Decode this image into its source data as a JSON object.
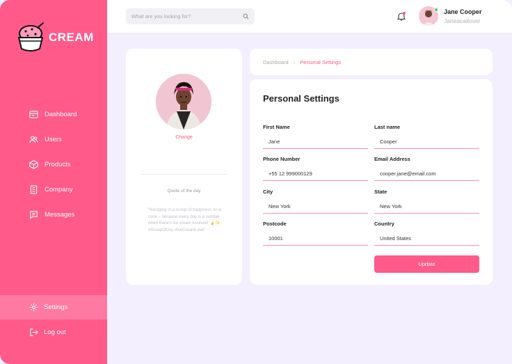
{
  "brand": {
    "name": "CREAM"
  },
  "nav": {
    "items": [
      {
        "label": "Dashboard",
        "icon": "dashboard-icon"
      },
      {
        "label": "Users",
        "icon": "users-icon"
      },
      {
        "label": "Products",
        "icon": "box-icon"
      },
      {
        "label": "Company",
        "icon": "building-icon"
      },
      {
        "label": "Messages",
        "icon": "message-icon"
      }
    ],
    "settings": "Settings",
    "logout": "Log out"
  },
  "header": {
    "search_placeholder": "What are you looking for?",
    "user_name": "Jane Cooper",
    "user_handle": "Janeacailover"
  },
  "profile": {
    "change_label": "Change",
    "quote_title": "Quote of the day",
    "quote_text": "\"Indulging in a scoop of happiness on a cone – because every day is a sundae when there's ice cream involved! 🍦✨ #ScoopOfJoy #IceCreamLove\""
  },
  "breadcrumb": {
    "parent": "Dashboard",
    "separator": "›",
    "current": "Personal Settings"
  },
  "form": {
    "title": "Personal Settings",
    "fields": {
      "first_name": {
        "label": "First Name",
        "value": "Jane"
      },
      "last_name": {
        "label": "Last name",
        "value": "Cooper"
      },
      "phone": {
        "label": "Phone Number",
        "value": "+55 12 999000129"
      },
      "email": {
        "label": "Email Address",
        "value": "cooper.jane@email.com"
      },
      "city": {
        "label": "City",
        "value": "New York"
      },
      "state": {
        "label": "State",
        "value": "New York"
      },
      "postcode": {
        "label": "Postcode",
        "value": "10001"
      },
      "country": {
        "label": "Country",
        "value": "United States"
      }
    },
    "submit_label": "Update"
  },
  "colors": {
    "accent": "#ff5a8a",
    "background": "#f3effe",
    "card": "#ffffff"
  }
}
